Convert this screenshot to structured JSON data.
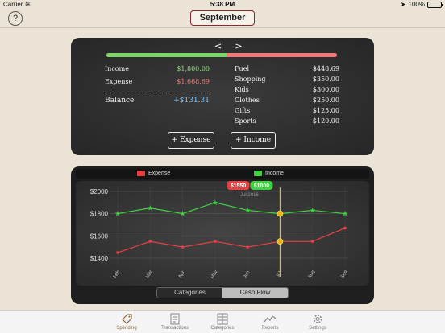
{
  "status_bar": {
    "carrier": "Carrier",
    "time": "5:38 PM",
    "battery": "100%"
  },
  "nav": {
    "help_label": "?",
    "month": "September"
  },
  "board": {
    "pager_prev": "<",
    "pager_next": ">",
    "income_share": 0.52,
    "colors": {
      "income": "#7ed36a",
      "expense": "#ef7878",
      "balance": "#7fc8ff"
    },
    "summary": [
      {
        "label": "Income",
        "value": "$1,800.00",
        "kind": "income"
      },
      {
        "label": "Expense",
        "value": "$1,668.69",
        "kind": "expense"
      },
      {
        "label": "Balance",
        "value": "+$131.31",
        "kind": "balance"
      }
    ],
    "categories": [
      {
        "label": "Fuel",
        "value": "$448.69"
      },
      {
        "label": "Shopping",
        "value": "$350.00"
      },
      {
        "label": "Kids",
        "value": "$300.00"
      },
      {
        "label": "Clothes",
        "value": "$250.00"
      },
      {
        "label": "Gifts",
        "value": "$125.00"
      },
      {
        "label": "Sports",
        "value": "$120.00"
      }
    ],
    "add_expense_label": "+ Expense",
    "add_income_label": "+ Income"
  },
  "legend": {
    "expense": "Expense",
    "income": "Income"
  },
  "chart_data": {
    "type": "line",
    "categories": [
      "Feb",
      "Mar",
      "Apr",
      "May",
      "Jun",
      "Jul",
      "Aug",
      "Sep"
    ],
    "series": [
      {
        "name": "Expense",
        "color": "#e84040",
        "values": [
          1450,
          1550,
          1500,
          1550,
          1500,
          1550,
          1550,
          1670
        ]
      },
      {
        "name": "Income",
        "color": "#3fd13f",
        "values": [
          1800,
          1850,
          1800,
          1900,
          1830,
          1800,
          1830,
          1800
        ]
      }
    ],
    "yticks": [
      "$2000",
      "$1800",
      "$1600",
      "$1400"
    ],
    "ylim": [
      1320,
      2050
    ],
    "tooltip": {
      "expense": "$1550",
      "income": "$1800",
      "label": "Jul 2016",
      "index": 5
    }
  },
  "segments": {
    "categories": "Categories",
    "cashflow": "Cash Flow",
    "active": "cashflow"
  },
  "tabs": [
    {
      "label": "Spending",
      "icon": "tag-icon",
      "active": true
    },
    {
      "label": "Transactions",
      "icon": "receipt-icon",
      "active": false
    },
    {
      "label": "Categories",
      "icon": "grid-icon",
      "active": false
    },
    {
      "label": "Reports",
      "icon": "line-chart-icon",
      "active": false
    },
    {
      "label": "Settings",
      "icon": "gear-icon",
      "active": false
    }
  ]
}
